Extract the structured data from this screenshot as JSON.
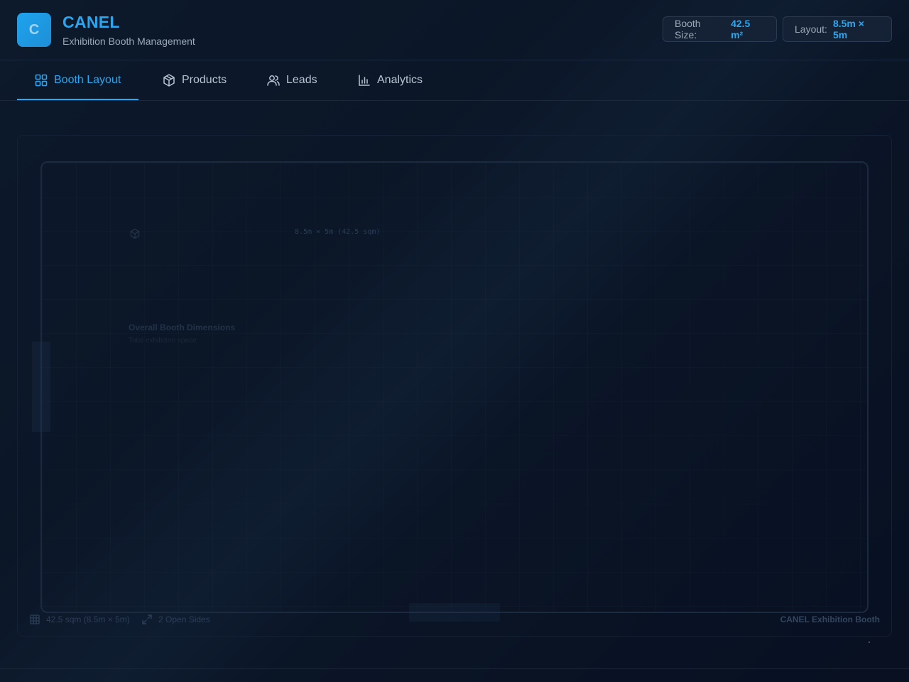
{
  "app": {
    "logo_letter": "C",
    "title": "CANEL",
    "subtitle": "Exhibition Booth Management"
  },
  "stats": {
    "booth_size_label": "Booth Size:",
    "booth_size_value": "42.5 m²",
    "layout_label": "Layout:",
    "layout_value": "8.5m × 5m"
  },
  "tabs": [
    {
      "label": "Booth Layout",
      "icon": "grid-icon",
      "active": true
    },
    {
      "label": "Products",
      "icon": "box-icon",
      "active": false
    },
    {
      "label": "Leads",
      "icon": "users-icon",
      "active": false
    },
    {
      "label": "Analytics",
      "icon": "bar-chart-icon",
      "active": false
    }
  ],
  "booth": {
    "dimension_text": "8.5m × 5m (42.5 sqm)",
    "overall_title": "Overall Booth Dimensions",
    "overall_subtitle": "Total exhibition space"
  },
  "footer": {
    "area_text": "42.5 sqm (8.5m × 5m)",
    "sides_text": "2 Open Sides",
    "brand_text": "CANEL Exhibition Booth"
  },
  "colors": {
    "accent": "#2aa7f0",
    "background": "#0b1627"
  }
}
